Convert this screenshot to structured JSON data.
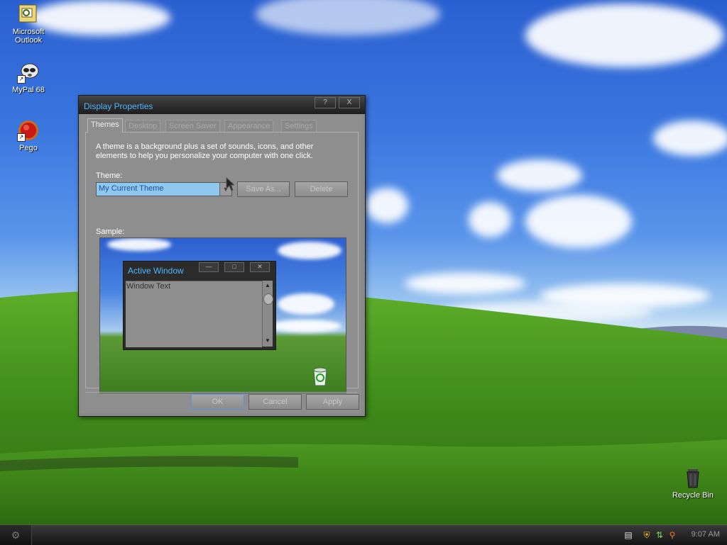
{
  "desktop": {
    "icons": [
      {
        "label": "Microsoft\nOutlook",
        "icon": "outlook-icon"
      },
      {
        "label": "MyPal 68",
        "icon": "mypal-icon"
      },
      {
        "label": "Pego",
        "icon": "pego-icon"
      },
      {
        "label": "Recycle Bin",
        "icon": "recycle-bin-icon"
      }
    ]
  },
  "dialog": {
    "title": "Display Properties",
    "help_button": "?",
    "close_button": "X",
    "tabs": [
      {
        "label": "Themes",
        "active": true
      },
      {
        "label": "Desktop",
        "active": false
      },
      {
        "label": "Screen Saver",
        "active": false
      },
      {
        "label": "Appearance",
        "active": false
      },
      {
        "label": "Settings",
        "active": false
      }
    ],
    "description": "A theme is a background plus a set of sounds, icons, and other elements to help you personalize your computer with one click.",
    "theme_label": "Theme:",
    "theme_value": "My Current Theme",
    "save_as_label": "Save As...",
    "delete_label": "Delete",
    "sample_label": "Sample:",
    "sample": {
      "window_title": "Active Window",
      "window_text": "Window Text"
    },
    "ok_label": "OK",
    "cancel_label": "Cancel",
    "apply_label": "Apply"
  },
  "taskbar": {
    "clock": "9:07 AM",
    "tray_icons": [
      "keyboard-icon",
      "security-shield-icon",
      "network-icon",
      "search-icon"
    ]
  },
  "colors": {
    "title_text": "#4fb6ff",
    "window_frame": "#2b2b2b",
    "window_body": "#8e8e8e",
    "selection": "#8fc8ee"
  }
}
